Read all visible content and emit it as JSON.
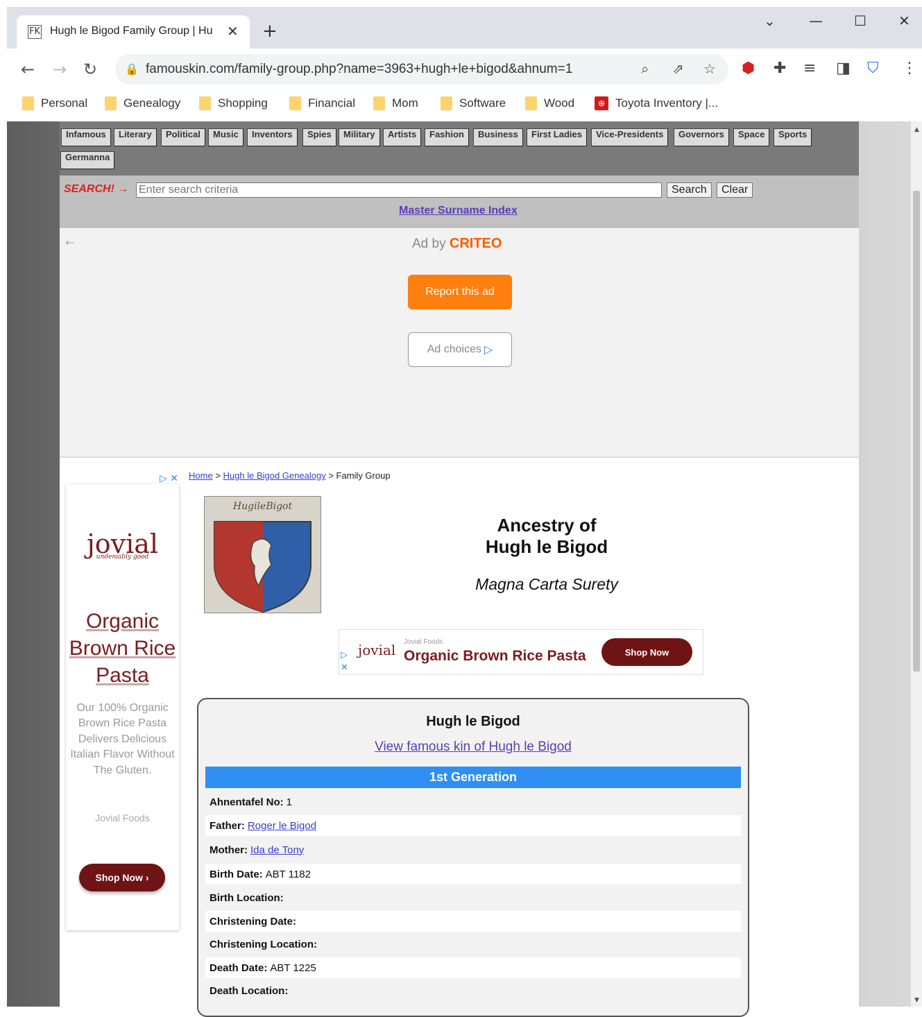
{
  "browser": {
    "tab_title": "Hugh le Bigod Family Group | Hu",
    "tab_favicon": "FK",
    "url": "famouskin.com/family-group.php?name=3963+hugh+le+bigod&ahnum=1",
    "bookmarks": [
      "Personal",
      "Genealogy",
      "Shopping",
      "Financial",
      "Mom",
      "Software",
      "Wood",
      "Toyota Inventory |..."
    ]
  },
  "categories": [
    "Infamous",
    "Literary",
    "Political",
    "Music",
    "Inventors",
    "Spies",
    "Military",
    "Artists",
    "Fashion",
    "Business",
    "First Ladies",
    "Vice-Presidents",
    "Governors",
    "Space",
    "Sports",
    "Germanna"
  ],
  "search": {
    "label": "SEARCH! →",
    "placeholder": "Enter search criteria",
    "search_btn": "Search",
    "clear_btn": "Clear",
    "surname_index": "Master Surname Index"
  },
  "ad": {
    "ad_by": "Ad by",
    "brand": "CRITEO",
    "report": "Report this ad",
    "choices": "Ad choices"
  },
  "side_ad": {
    "logo": "jovial",
    "logo_sub": "undeniably good",
    "headline": "Organic Brown Rice Pasta",
    "description": "Our 100% Organic Brown Rice Pasta Delivers Delicious Italian Flavor Without The Gluten.",
    "brand": "Jovial Foods",
    "cta": "Shop Now ›"
  },
  "breadcrumb": {
    "home": "Home",
    "sep1": ">",
    "genealogy": "Hugh le Bigod Genealogy",
    "sep2": ">",
    "current": "Family Group"
  },
  "header": {
    "title_line1": "Ancestry of",
    "title_line2": "Hugh le Bigod",
    "subtitle": "Magna Carta Surety",
    "coat_caption": "HugileBigot"
  },
  "banner_ad": {
    "logo": "jovial",
    "brand": "Jovial Foods",
    "headline": "Organic Brown Rice Pasta",
    "cta": "Shop Now"
  },
  "person": {
    "name": "Hugh le Bigod",
    "kin_link": "View famous kin of Hugh le Bigod",
    "generation": "1st Generation",
    "fields": [
      {
        "label": "Ahnentafel No:",
        "value": "1",
        "link": false
      },
      {
        "label": "Father:",
        "value": "Roger le Bigod",
        "link": true
      },
      {
        "label": "Mother:",
        "value": "Ida de Tony",
        "link": true
      },
      {
        "label": "Birth Date:",
        "value": "ABT 1182",
        "link": false
      },
      {
        "label": "Birth Location:",
        "value": "",
        "link": false
      },
      {
        "label": "Christening Date:",
        "value": "",
        "link": false
      },
      {
        "label": "Christening Location:",
        "value": "",
        "link": false
      },
      {
        "label": "Death Date:",
        "value": "ABT 1225",
        "link": false
      },
      {
        "label": "Death Location:",
        "value": "",
        "link": false
      }
    ]
  },
  "colors": {
    "generation_bar": "#2f8ff2",
    "link": "#5a3db8",
    "ad_orange": "#ff7f0f",
    "jovial_red": "#7b1c20"
  }
}
